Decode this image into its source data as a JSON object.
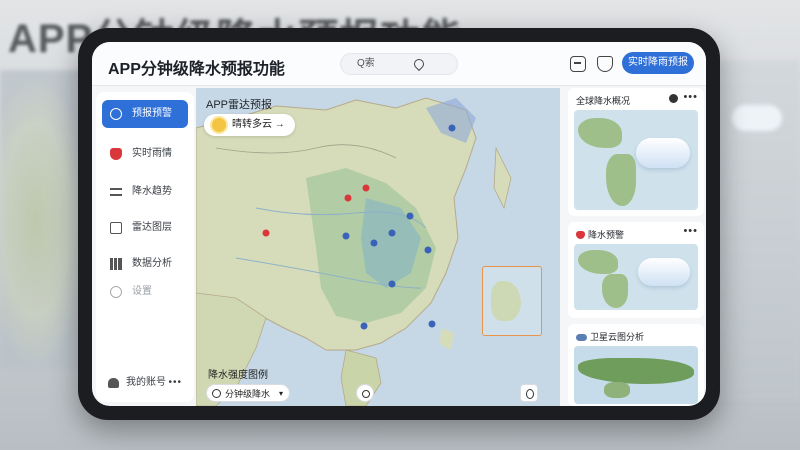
{
  "backdrop": {
    "title": "APP分钟级降水预报功能"
  },
  "header": {
    "title": "APP分钟级降水预报功能",
    "search_placeholder": "Q索",
    "primary_button": "实时降雨预报"
  },
  "sidebar": {
    "items": [
      {
        "label": "预报预警",
        "active": true
      },
      {
        "label": "实时雨情"
      },
      {
        "label": "降水趋势"
      },
      {
        "label": "雷达图层"
      },
      {
        "label": "数据分析"
      },
      {
        "label": "设置"
      }
    ],
    "footer": {
      "label": "我的账号",
      "more": "•••"
    }
  },
  "map": {
    "title": "APP雷达预报",
    "weather_chip": "晴转多云 →",
    "footer_text": "降水强度图例",
    "select_label": "分钟级降水",
    "select_chevron": "▾"
  },
  "cards": [
    {
      "title": "全球降水概况",
      "more": "•••"
    },
    {
      "title": "降水预警",
      "more": "•••"
    },
    {
      "title": "卫星云图分析",
      "more": ""
    }
  ],
  "colors": {
    "accent": "#2e6fd8",
    "alert": "#d9373a",
    "inset_border": "#e9944a"
  }
}
